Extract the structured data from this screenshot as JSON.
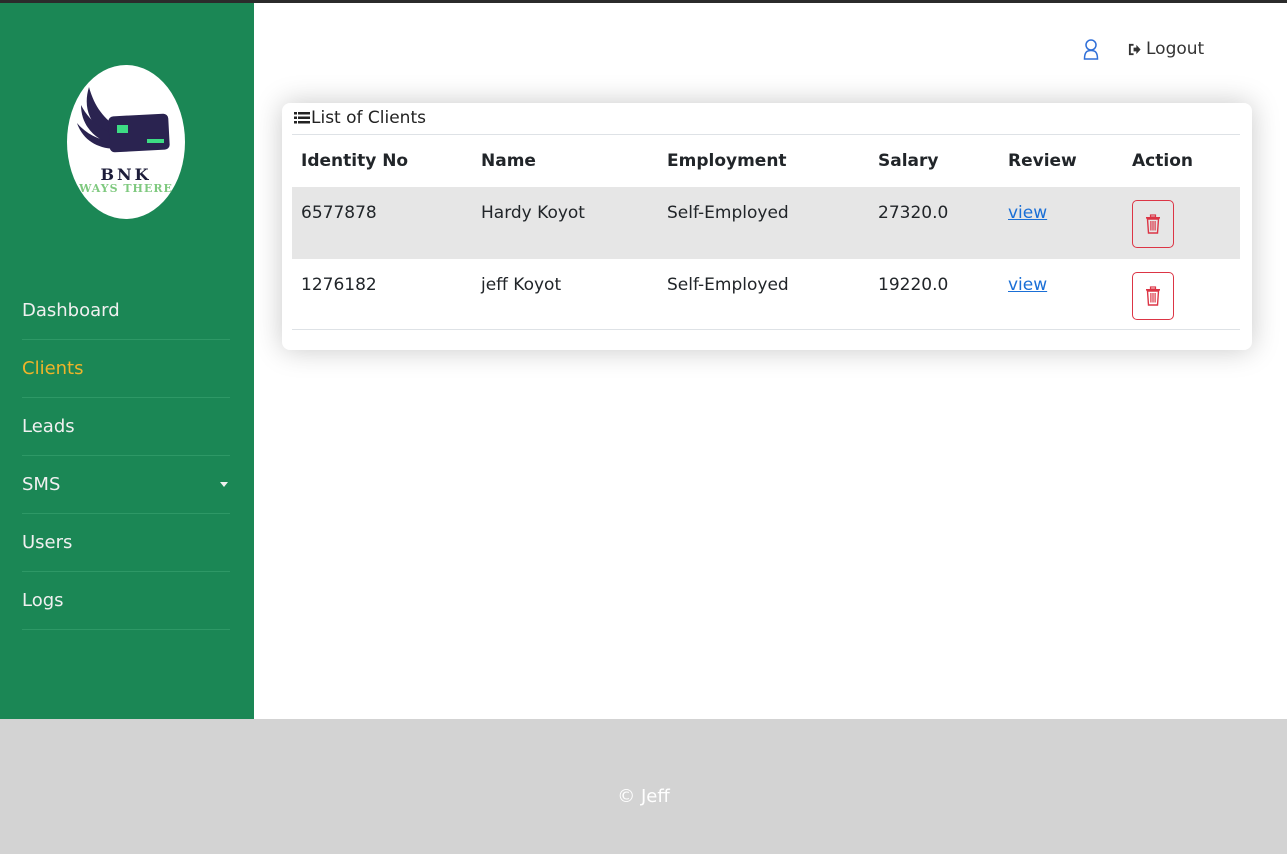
{
  "logo": {
    "brand": "BNK",
    "tagline": "WAYS THERE"
  },
  "sidebar": {
    "items": [
      {
        "label": "Dashboard"
      },
      {
        "label": "Clients",
        "active": true
      },
      {
        "label": "Leads"
      },
      {
        "label": "SMS",
        "has_dropdown": true
      },
      {
        "label": "Users"
      },
      {
        "label": "Logs"
      }
    ]
  },
  "header": {
    "logout_label": "Logout"
  },
  "card": {
    "title": "List of Clients",
    "columns": [
      "Identity No",
      "Name",
      "Employment",
      "Salary",
      "Review",
      "Action"
    ],
    "rows": [
      {
        "identity_no": "6577878",
        "name": "Hardy Koyot",
        "employment": "Self-Employed",
        "salary": "27320.0",
        "review": "view"
      },
      {
        "identity_no": "1276182",
        "name": "jeff Koyot",
        "employment": "Self-Employed",
        "salary": "19220.0",
        "review": "view"
      }
    ]
  },
  "footer": {
    "copyright": "© Jeff"
  },
  "colors": {
    "sidebar": "#1b8755",
    "active_nav": "#f0b429",
    "link": "#1a6fd6",
    "danger": "#dc3545",
    "footer": "#d3d3d3"
  }
}
